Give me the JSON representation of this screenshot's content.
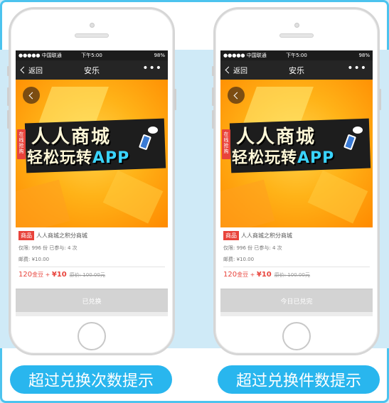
{
  "colors": {
    "accent_blue": "#29b6ee",
    "price_red": "#e8433b",
    "disabled_gray": "#d3d3d3",
    "banner_orange": "#ffb318"
  },
  "phones": [
    {
      "status": {
        "carrier": "●●●●● 中国联通",
        "time": "下午5:00",
        "battery": "98%"
      },
      "nav": {
        "back": "返回",
        "title": "安乐",
        "more": "•••"
      },
      "banner": {
        "tag": "在线抢购",
        "line1": "人人商城",
        "line2a": "轻松玩转",
        "line2b": "APP",
        "back_icon": "chevron-left-icon"
      },
      "product": {
        "badge": "商品",
        "name": "人人商城之积分商城",
        "limit": "仅限: 996 份 已参与: 4 次",
        "postage": "邮费: ¥10.00",
        "price_points": "120",
        "price_points_unit": "金豆",
        "price_plus": " + ",
        "price_cash": "¥10",
        "original_price": "原价: 100.00元"
      },
      "action": "已兑换"
    },
    {
      "status": {
        "carrier": "●●●●● 中国联通",
        "time": "下午5:00",
        "battery": "98%"
      },
      "nav": {
        "back": "返回",
        "title": "安乐",
        "more": "•••"
      },
      "banner": {
        "tag": "在线抢购",
        "line1": "人人商城",
        "line2a": "轻松玩转",
        "line2b": "APP",
        "back_icon": "chevron-left-icon"
      },
      "product": {
        "badge": "商品",
        "name": "人人商城之积分商城",
        "limit": "仅限: 996 份 已参与: 4 次",
        "postage": "邮费: ¥10.00",
        "price_points": "120",
        "price_points_unit": "金豆",
        "price_plus": " + ",
        "price_cash": "¥10",
        "original_price": "原价: 100.00元"
      },
      "action": "今日已兑完"
    }
  ],
  "captions": {
    "left": "超过兑换次数提示",
    "right": "超过兑换件数提示"
  }
}
